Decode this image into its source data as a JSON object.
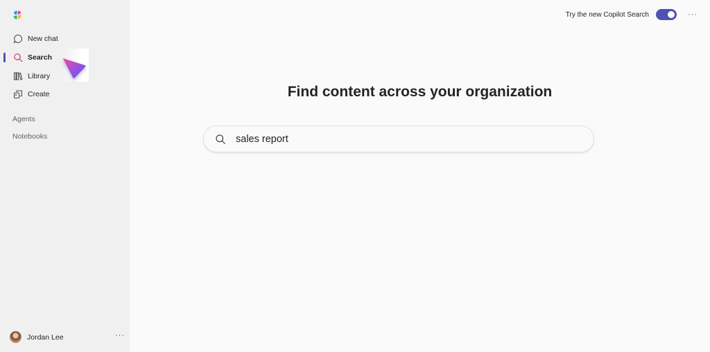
{
  "sidebar": {
    "items": [
      {
        "label": "New chat",
        "icon": "chat-bubble-icon"
      },
      {
        "label": "Search",
        "icon": "search-icon",
        "active": true
      },
      {
        "label": "Library",
        "icon": "library-icon"
      },
      {
        "label": "Create",
        "icon": "create-icon"
      }
    ],
    "sections": [
      "Agents",
      "Notebooks"
    ],
    "user": {
      "name": "Jordan Lee",
      "more": "···"
    }
  },
  "header": {
    "toggle_label": "Try the new Copilot Search",
    "toggle_on": true,
    "more": "···"
  },
  "main": {
    "title": "Find content across your organization",
    "search": {
      "value": "sales report"
    }
  },
  "colors": {
    "accent": "#4f52b2",
    "sidebar_bg": "#f0f0f0",
    "page_bg": "#fafafa"
  }
}
